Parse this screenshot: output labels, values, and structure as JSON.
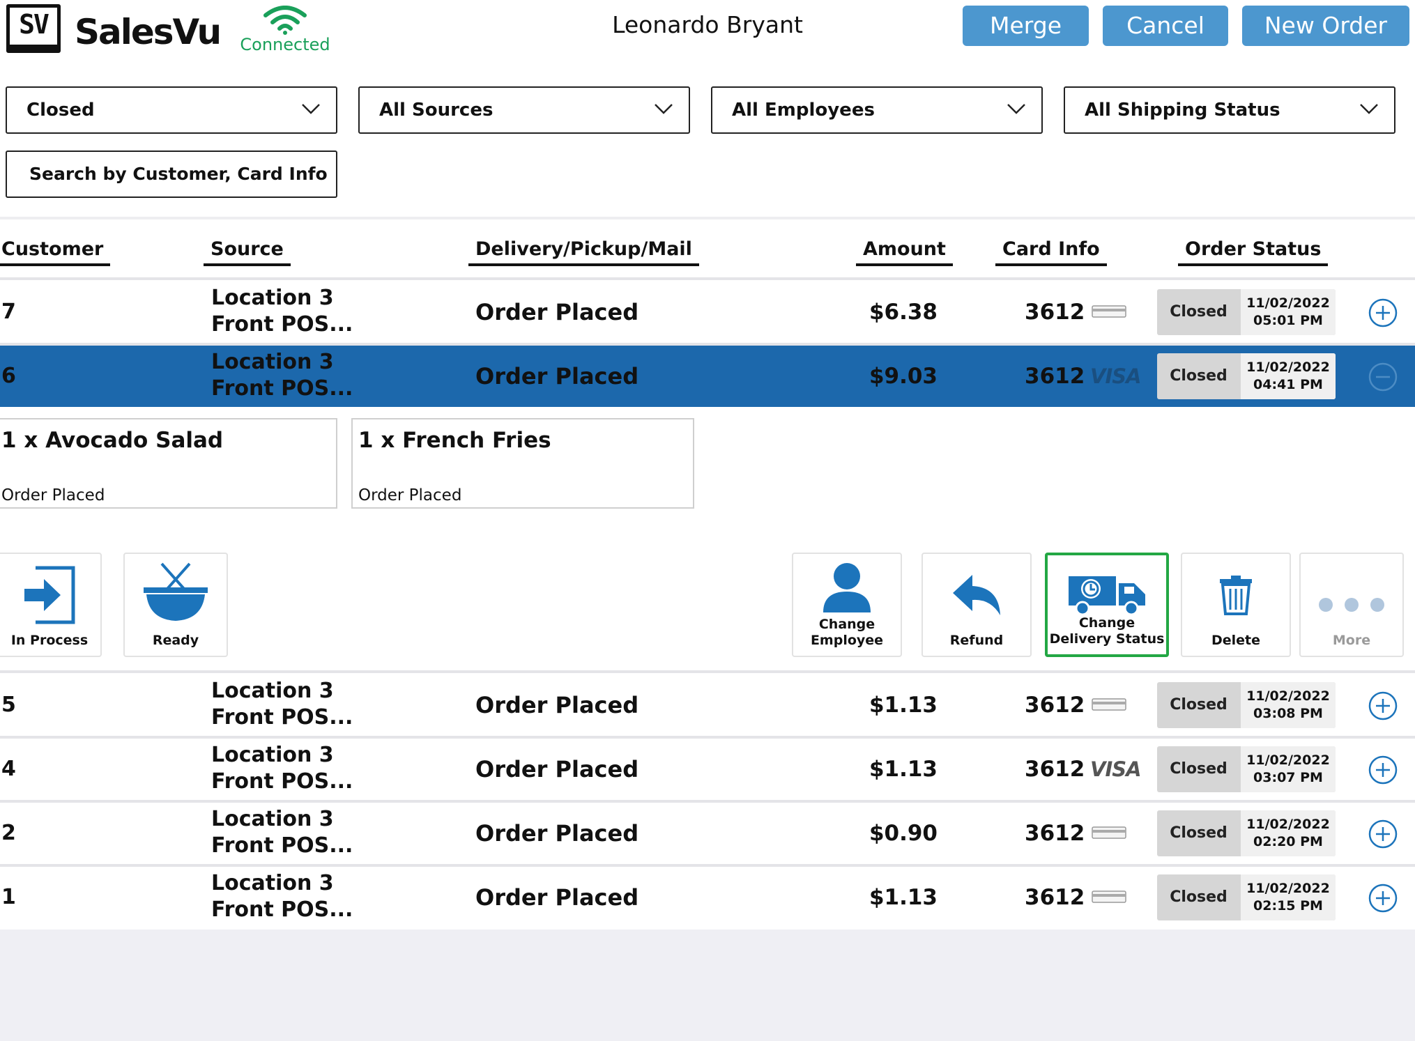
{
  "app": {
    "logo_text": "SV",
    "brand": "SalesVu",
    "connection_status": "Connected",
    "employee_name": "Leonardo Bryant"
  },
  "toolbar": {
    "merge_label": "Merge",
    "cancel_label": "Cancel",
    "new_order_label": "New Order"
  },
  "filters": {
    "status": "Closed",
    "source": "All Sources",
    "employee": "All Employees",
    "shipping": "All Shipping Status"
  },
  "search": {
    "placeholder": "Search by Customer, Card Info"
  },
  "table": {
    "columns": {
      "customer": "Customer",
      "source": "Source",
      "delivery": "Delivery/Pickup/Mail",
      "amount": "Amount",
      "card": "Card Info",
      "status": "Order Status"
    },
    "rows": [
      {
        "customer": "7",
        "source_line1": "Location 3",
        "source_line2": "Front POS...",
        "delivery": "Order Placed",
        "amount": "$6.38",
        "card": "3612",
        "card_brand": "card-icon",
        "status": "Closed",
        "date": "11/02/2022",
        "time": "05:01 PM",
        "expanded": false
      },
      {
        "customer": "6",
        "source_line1": "Location 3",
        "source_line2": "Front POS...",
        "delivery": "Order Placed",
        "amount": "$9.03",
        "card": "3612",
        "card_brand": "VISA",
        "status": "Closed",
        "date": "11/02/2022",
        "time": "04:41 PM",
        "expanded": true
      },
      {
        "customer": "5",
        "source_line1": "Location 3",
        "source_line2": "Front POS...",
        "delivery": "Order Placed",
        "amount": "$1.13",
        "card": "3612",
        "card_brand": "card-icon",
        "status": "Closed",
        "date": "11/02/2022",
        "time": "03:08 PM",
        "expanded": false
      },
      {
        "customer": "4",
        "source_line1": "Location 3",
        "source_line2": "Front POS...",
        "delivery": "Order Placed",
        "amount": "$1.13",
        "card": "3612",
        "card_brand": "VISA",
        "status": "Closed",
        "date": "11/02/2022",
        "time": "03:07 PM",
        "expanded": false
      },
      {
        "customer": "2",
        "source_line1": "Location 3",
        "source_line2": "Front POS...",
        "delivery": "Order Placed",
        "amount": "$0.90",
        "card": "3612",
        "card_brand": "card-icon",
        "status": "Closed",
        "date": "11/02/2022",
        "time": "02:20 PM",
        "expanded": false
      },
      {
        "customer": "1",
        "source_line1": "Location 3",
        "source_line2": "Front POS...",
        "delivery": "Order Placed",
        "amount": "$1.13",
        "card": "3612",
        "card_brand": "card-icon",
        "status": "Closed",
        "date": "11/02/2022",
        "time": "02:15 PM",
        "expanded": false
      }
    ]
  },
  "order_items": [
    {
      "name": "1 x Avocado Salad",
      "status": "Order Placed"
    },
    {
      "name": "1 x French Fries",
      "status": "Order Placed"
    }
  ],
  "actions": {
    "in_process": "In Process",
    "ready": "Ready",
    "change_employee_1": "Change",
    "change_employee_2": "Employee",
    "refund": "Refund",
    "change_delivery_1": "Change",
    "change_delivery_2": "Delivery Status",
    "delete": "Delete",
    "more": "More"
  },
  "colors": {
    "accent": "#4c97cf",
    "selected_row": "#1c68ac",
    "connected": "#1aa05a",
    "icon_blue": "#1c74bb",
    "highlight": "#23a744"
  }
}
